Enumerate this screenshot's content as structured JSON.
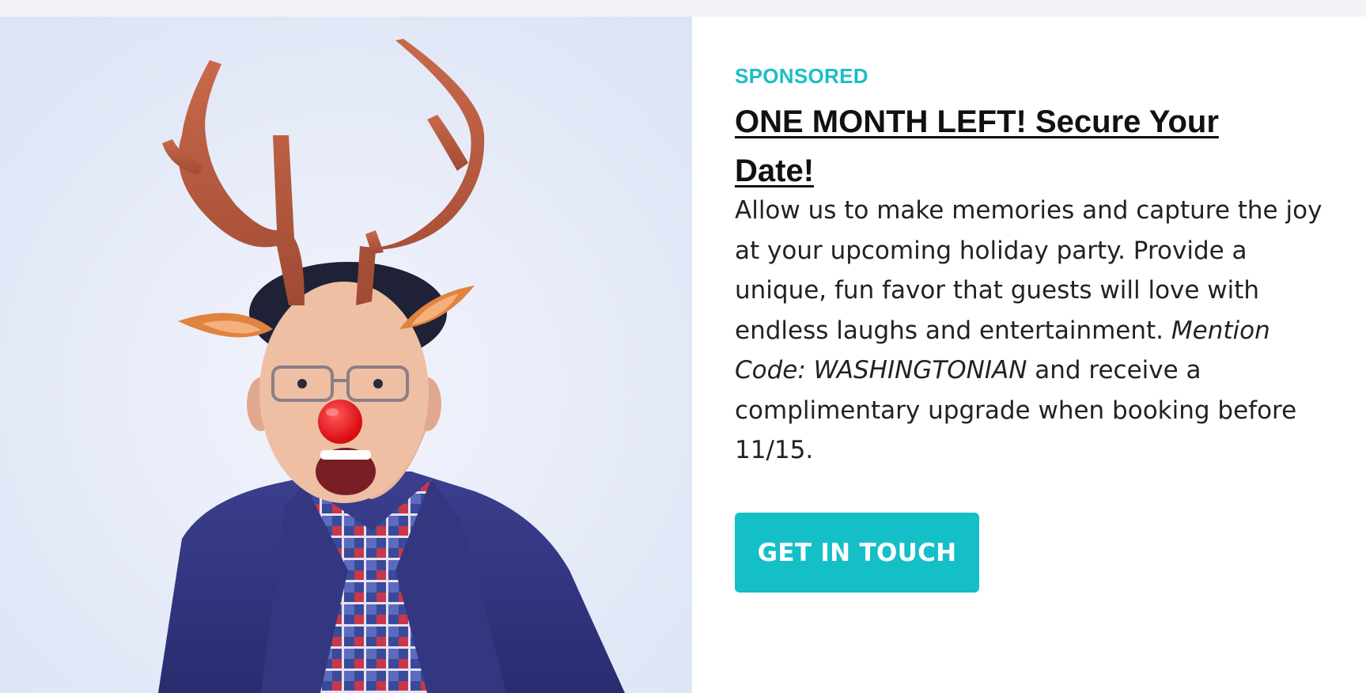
{
  "ad": {
    "label": "SPONSORED",
    "headline": "ONE MONTH LEFT! Secure Your Date!",
    "body_part1": "Allow us to make memories and capture the joy at your upcoming holiday party. Provide a unique, fun favor that guests will love with endless laughs and entertainment. ",
    "body_emphasis": "Mention Code: WASHINGTONIAN",
    "body_part2": " and receive a complimentary upgrade when booking before 11/15.",
    "cta_label": "GET IN TOUCH"
  },
  "colors": {
    "accent": "#14bfc7",
    "page_background": "#f1f3f7"
  },
  "image": {
    "icon": "reindeer-photo-booth-image"
  }
}
